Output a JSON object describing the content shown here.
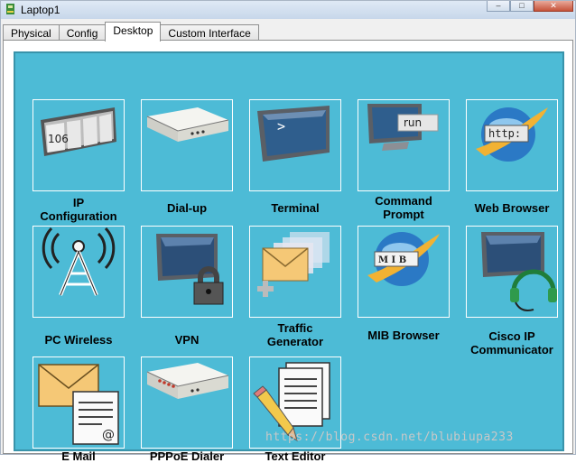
{
  "window": {
    "title": "Laptop1"
  },
  "tabs": [
    {
      "label": "Physical"
    },
    {
      "label": "Config"
    },
    {
      "label": "Desktop"
    },
    {
      "label": "Custom Interface"
    }
  ],
  "apps": [
    {
      "label": "IP\nConfiguration",
      "icon": "ip-config-icon"
    },
    {
      "label": "Dial-up",
      "icon": "modem-icon"
    },
    {
      "label": "Terminal",
      "icon": "terminal-icon"
    },
    {
      "label": "Command\nPrompt",
      "icon": "command-prompt-icon"
    },
    {
      "label": "Web Browser",
      "icon": "web-browser-icon"
    },
    {
      "label": "PC Wireless",
      "icon": "wireless-tower-icon"
    },
    {
      "label": "VPN",
      "icon": "vpn-lock-icon"
    },
    {
      "label": "Traffic\nGenerator",
      "icon": "traffic-envelope-icon"
    },
    {
      "label": "MIB Browser",
      "icon": "mib-browser-icon"
    },
    {
      "label": "Cisco IP\nCommunicator",
      "icon": "headset-monitor-icon"
    },
    {
      "label": "E Mail",
      "icon": "email-icon"
    },
    {
      "label": "PPPoE Dialer",
      "icon": "pppoe-modem-icon"
    },
    {
      "label": "Text Editor",
      "icon": "text-editor-icon"
    }
  ],
  "icon_text": {
    "ip": "106",
    "prompt": "run",
    "browser": "http:",
    "mib": "M I B",
    "email_at": "@"
  },
  "watermark": "https://blog.csdn.net/blubiupa233"
}
